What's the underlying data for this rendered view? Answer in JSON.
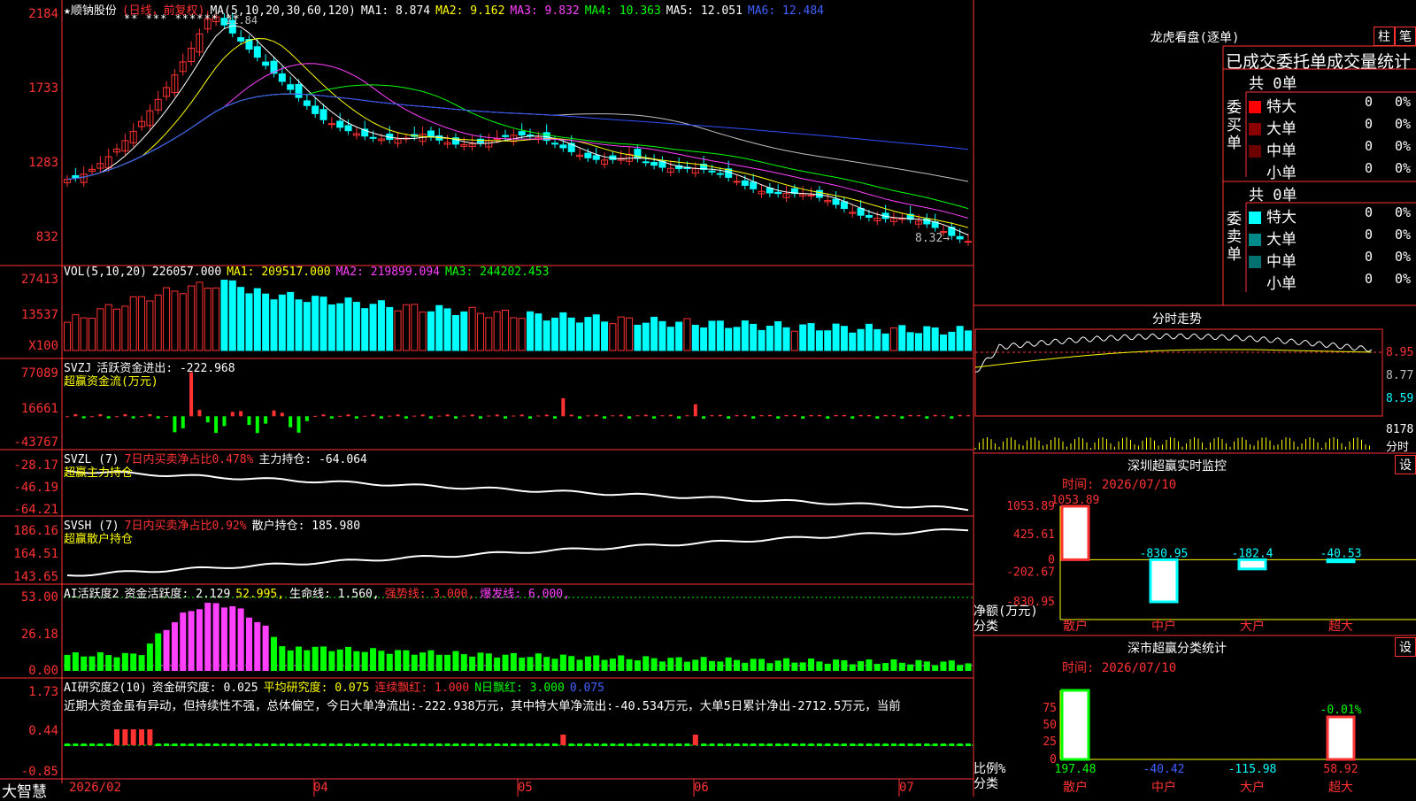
{
  "app": {
    "brand": "大智慧"
  },
  "header": {
    "stock": "★顺钠股份",
    "period": "(日线，前复权)",
    "ma_label": "MA(5,10,20,30,60,120)",
    "ma1": "MA1: 8.874",
    "ma2": "MA2: 9.162",
    "ma3": "MA3: 9.832",
    "ma4": "MA4: 10.363",
    "ma5": "MA5: 12.051",
    "ma6": "MA6: 12.484",
    "arrow_down": "↓",
    "arrow_up": "↑",
    "stars": "** *** ****** **",
    "high_mark": "21.84",
    "low_mark": "8.32→",
    "cross_mark": "+"
  },
  "price_axis": [
    "2184",
    "1733",
    "1283",
    "832"
  ],
  "vol": {
    "label": "VOL(5,10,20)",
    "value": "226057.000",
    "ma1": "MA1: 209517.000",
    "ma2": "MA2: 219899.094",
    "ma3": "MA3: 244202.453",
    "axis": [
      "27413",
      "13537",
      "X100"
    ]
  },
  "svzj": {
    "label": "SVZJ",
    "line1": "活跃资金进出: -222.968",
    "line2": "超赢资金流(万元)",
    "axis": [
      "77089",
      "16661",
      "-43767"
    ]
  },
  "svzl": {
    "label": "SVZL (7)",
    "text1": "7日内买卖净占比0.478%",
    "text2": "主力持仓: -64.064",
    "line2": "超赢主力持仓",
    "axis": [
      "-28.17",
      "-46.19",
      "-64.21"
    ]
  },
  "svsh": {
    "label": "SVSH (7)",
    "text1": "7日内买卖净占比0.92%",
    "text2": "散户持仓: 185.980",
    "line2": "超赢散户持仓",
    "axis": [
      "186.16",
      "164.51",
      "143.65"
    ]
  },
  "ai1": {
    "label": "AI活跃度2",
    "t1": "资金活跃度: 2.129",
    "t2": "52.995,",
    "t3": "生命线: 1.560,",
    "t4": "强势线: 3.000,",
    "t5": "爆发线: 6.000,",
    "axis": [
      "53.00",
      "26.18",
      "0.00"
    ]
  },
  "ai2": {
    "label": "AI研究度2(10)",
    "t1": "资金研究度: 0.025",
    "t2": "平均研究度: 0.075",
    "t3": "连续飘红: 1.000",
    "t4": "N日飘红: 3.000",
    "t5": "0.075",
    "comment": "近期大资金虽有异动，但持续性不强，总体偏空，今日大单净流出:-222.938万元，其中特大单净流出:-40.534万元，大单5日累计净出-2712.5万元，当前",
    "axis": [
      "1.73",
      "0.44",
      "-0.85"
    ]
  },
  "date_axis": [
    "2026/02",
    "04",
    "05",
    "06",
    "07"
  ],
  "lhb": {
    "title": "龙虎看盘(逐单)",
    "btn1": "柱",
    "btn2": "笔",
    "subtitle": "已成交委托单成交量统计",
    "buy_label": [
      "委",
      "买",
      "单"
    ],
    "sell_label": [
      "委",
      "卖",
      "单"
    ],
    "buy_total": "共 0单",
    "sell_total": "共 0单",
    "buy_rows": [
      {
        "name": "特大",
        "count": "0",
        "pct": "0%",
        "color": "#ff0000"
      },
      {
        "name": "大单",
        "count": "0",
        "pct": "0%",
        "color": "#8b0000"
      },
      {
        "name": "中单",
        "count": "0",
        "pct": "0%",
        "color": "#6b0000"
      },
      {
        "name": "小单",
        "count": "0",
        "pct": "0%",
        "color": "#000000"
      }
    ],
    "sell_rows": [
      {
        "name": "特大",
        "count": "0",
        "pct": "0%",
        "color": "#00ffff"
      },
      {
        "name": "大单",
        "count": "0",
        "pct": "0%",
        "color": "#008b8b"
      },
      {
        "name": "中单",
        "count": "0",
        "pct": "0%",
        "color": "#007070"
      },
      {
        "name": "小单",
        "count": "0",
        "pct": "0%",
        "color": "#000000"
      }
    ]
  },
  "intraday": {
    "title": "分时走势",
    "axis": [
      "8.95",
      "8.77",
      "8.59"
    ],
    "vol_max": "8178",
    "vol_label": "分时"
  },
  "monitor": {
    "title": "深圳超赢实时监控",
    "set": "设",
    "time": "时间: 2026/07/10",
    "ylabel1": "净额(万元)",
    "ylabel2": "分类",
    "axis": [
      "1053.89",
      "425.61",
      "0",
      "-202.67",
      "-830.95"
    ]
  },
  "stats": {
    "title": "深市超赢分类统计",
    "set": "设",
    "time": "时间: 2026/07/10",
    "ylabel1": "比例%",
    "ylabel2": "分类",
    "axis": [
      "75",
      "50",
      "25",
      "0"
    ]
  },
  "chart_data": [
    {
      "type": "candlestick",
      "title": "★顺钠股份 (日线，前复权)",
      "ylim": [
        8.32,
        21.84
      ],
      "x": [
        "2026/02",
        "04",
        "05",
        "06",
        "07"
      ],
      "close_start": 11.8,
      "close_peak": 21.84,
      "close_end": 8.32,
      "ma": {
        "MA1": 8.874,
        "MA2": 9.162,
        "MA3": 9.832,
        "MA4": 10.363,
        "MA5": 12.051,
        "MA6": 12.484
      }
    },
    {
      "type": "bar",
      "title": "VOL(5,10,20)",
      "values_latest": 226057.0,
      "ma": {
        "MA1": 209517.0,
        "MA2": 219899.094,
        "MA3": 244202.453
      },
      "ylim": [
        0,
        27413
      ]
    },
    {
      "type": "bar",
      "title": "超赢资金流(万元)",
      "ylim": [
        -43767,
        77089
      ],
      "latest": -222.968
    },
    {
      "type": "bar",
      "title": "深圳超赢实时监控",
      "categories": [
        "散户",
        "中户",
        "大户",
        "超大"
      ],
      "values": [
        1053.89,
        -830.95,
        -182.4,
        -40.53
      ],
      "labels": [
        "1053.89",
        "-830.95",
        "-182.4",
        "-40.53"
      ],
      "ylim": [
        -830.95,
        1053.89
      ],
      "ylabel": "净额(万元)"
    },
    {
      "type": "bar",
      "title": "深市超赢分类统计",
      "categories": [
        "散户",
        "中户",
        "大户",
        "超大"
      ],
      "values": [
        197.48,
        -40.42,
        -115.98,
        58.92
      ],
      "labels": [
        "197.48",
        "-40.42",
        "-115.98",
        "58.92"
      ],
      "top_label": "-0.01%",
      "ylim": [
        0,
        75
      ],
      "ylabel": "比例%"
    }
  ]
}
